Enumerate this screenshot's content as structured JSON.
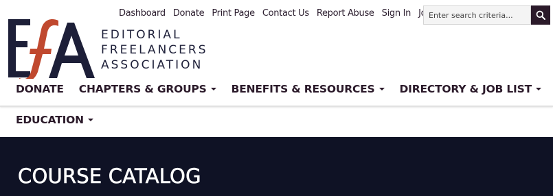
{
  "utility_nav": [
    "Dashboard",
    "Donate",
    "Print Page",
    "Contact Us",
    "Report Abuse",
    "Sign In",
    "Join"
  ],
  "search": {
    "placeholder": "Enter search criteria..."
  },
  "brand": {
    "line1": "EDITORIAL",
    "line2": "FREELANCERS",
    "line3": "ASSOCIATION",
    "logo_text": "EfA"
  },
  "main_nav": [
    {
      "label": "DONATE",
      "dropdown": false
    },
    {
      "label": "CHAPTERS & GROUPS",
      "dropdown": true
    },
    {
      "label": "BENEFITS & RESOURCES",
      "dropdown": true
    },
    {
      "label": "DIRECTORY & JOB LIST",
      "dropdown": true
    }
  ],
  "second_nav": [
    {
      "label": "EDUCATION",
      "dropdown": true
    }
  ],
  "hero": {
    "title": "COURSE CATALOG"
  },
  "colors": {
    "navy": "#1d1f38",
    "rust": "#c0492f",
    "plum": "#2b1a2a",
    "hero_bg": "#0f1225"
  }
}
